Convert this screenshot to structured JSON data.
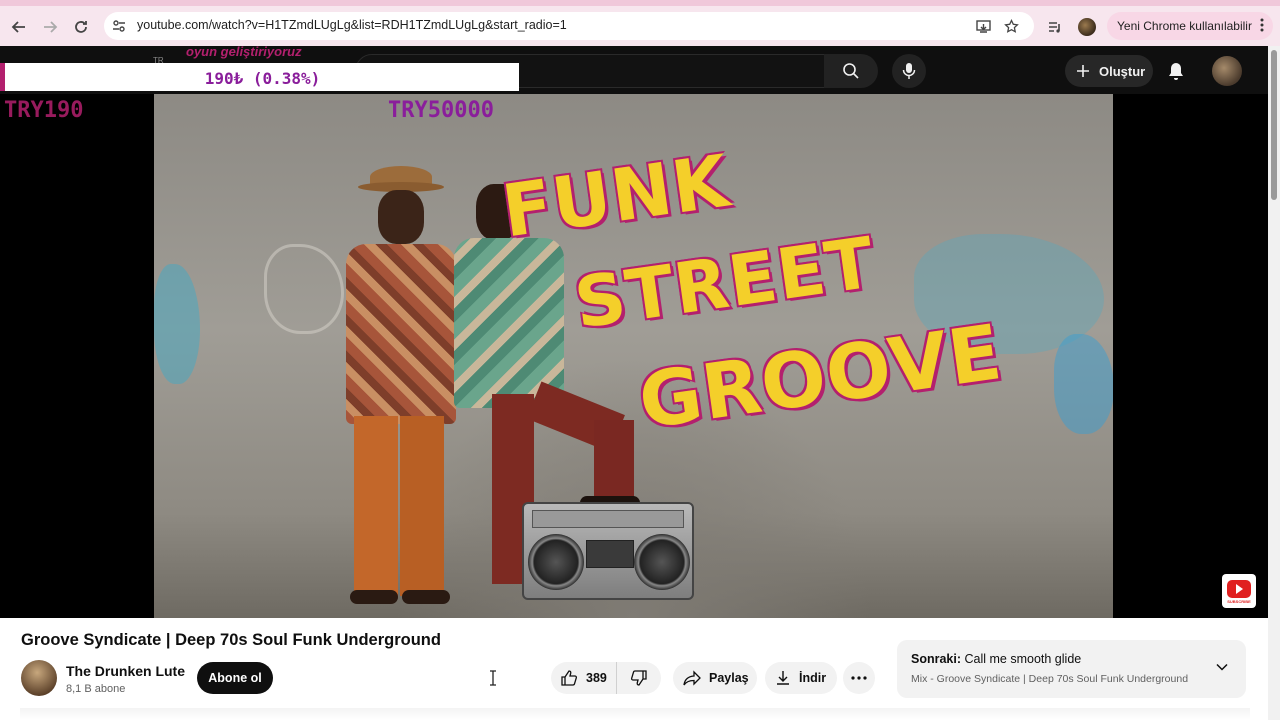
{
  "browser": {
    "url": "youtube.com/watch?v=H1TZmdLUgLg&list=RDH1TZmdLUgLg&start_radio=1",
    "update_label": "Yeni Chrome kullanılabilir"
  },
  "header": {
    "create_label": "Oluştur"
  },
  "overlay": {
    "stream_caption": "oyun geliştiriyoruz",
    "tr_tag": "TR",
    "goal_progress": "190₺ (0.38%)",
    "goal_fraction": 0.0038,
    "try_current": "TRY190",
    "try_target": "TRY50000"
  },
  "thumbnail": {
    "line1": "FUNK",
    "line2": "STREET",
    "line3": "GROOVE",
    "subscribe_mark": "SUBSCRIBE"
  },
  "video": {
    "title": "Groove Syndicate | Deep 70s Soul Funk Underground",
    "channel_name": "The Drunken Lute",
    "subscribers": "8,1 B abone",
    "subscribe_label": "Abone ol",
    "likes": "389",
    "share_label": "Paylaş",
    "download_label": "İndir"
  },
  "next_up": {
    "prefix": "Sonraki:",
    "title": "Call me smooth glide",
    "playlist": "Mix - Groove Syndicate | Deep 70s Soul Funk Underground"
  },
  "colors": {
    "accent_pink": "#b3206e",
    "title_yellow": "#f4cf2a",
    "yt_dark": "#0f0f0f"
  }
}
